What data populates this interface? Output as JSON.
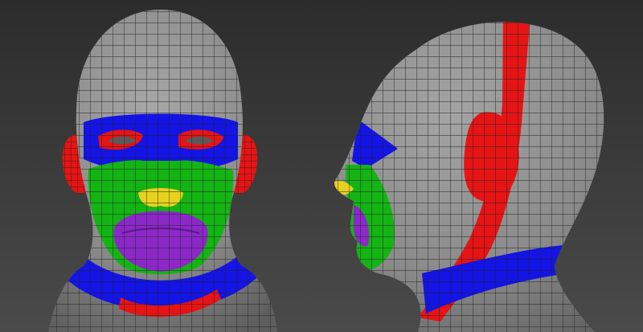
{
  "scene": {
    "background": [
      "#2c2c2c",
      "#4a4a4a"
    ],
    "mesh_color": "#8e8e8e",
    "wire_color": "#222222",
    "loop_colors": {
      "eyes": "#1414e6",
      "eyelids": "#e61414",
      "cheeks": "#14b414",
      "nose": "#e6d21e",
      "mouth": "#8c28c8",
      "neck": "#1414e6",
      "ear": "#e61414",
      "strip": "#e61414"
    },
    "views": [
      "front-view",
      "side-view"
    ]
  }
}
